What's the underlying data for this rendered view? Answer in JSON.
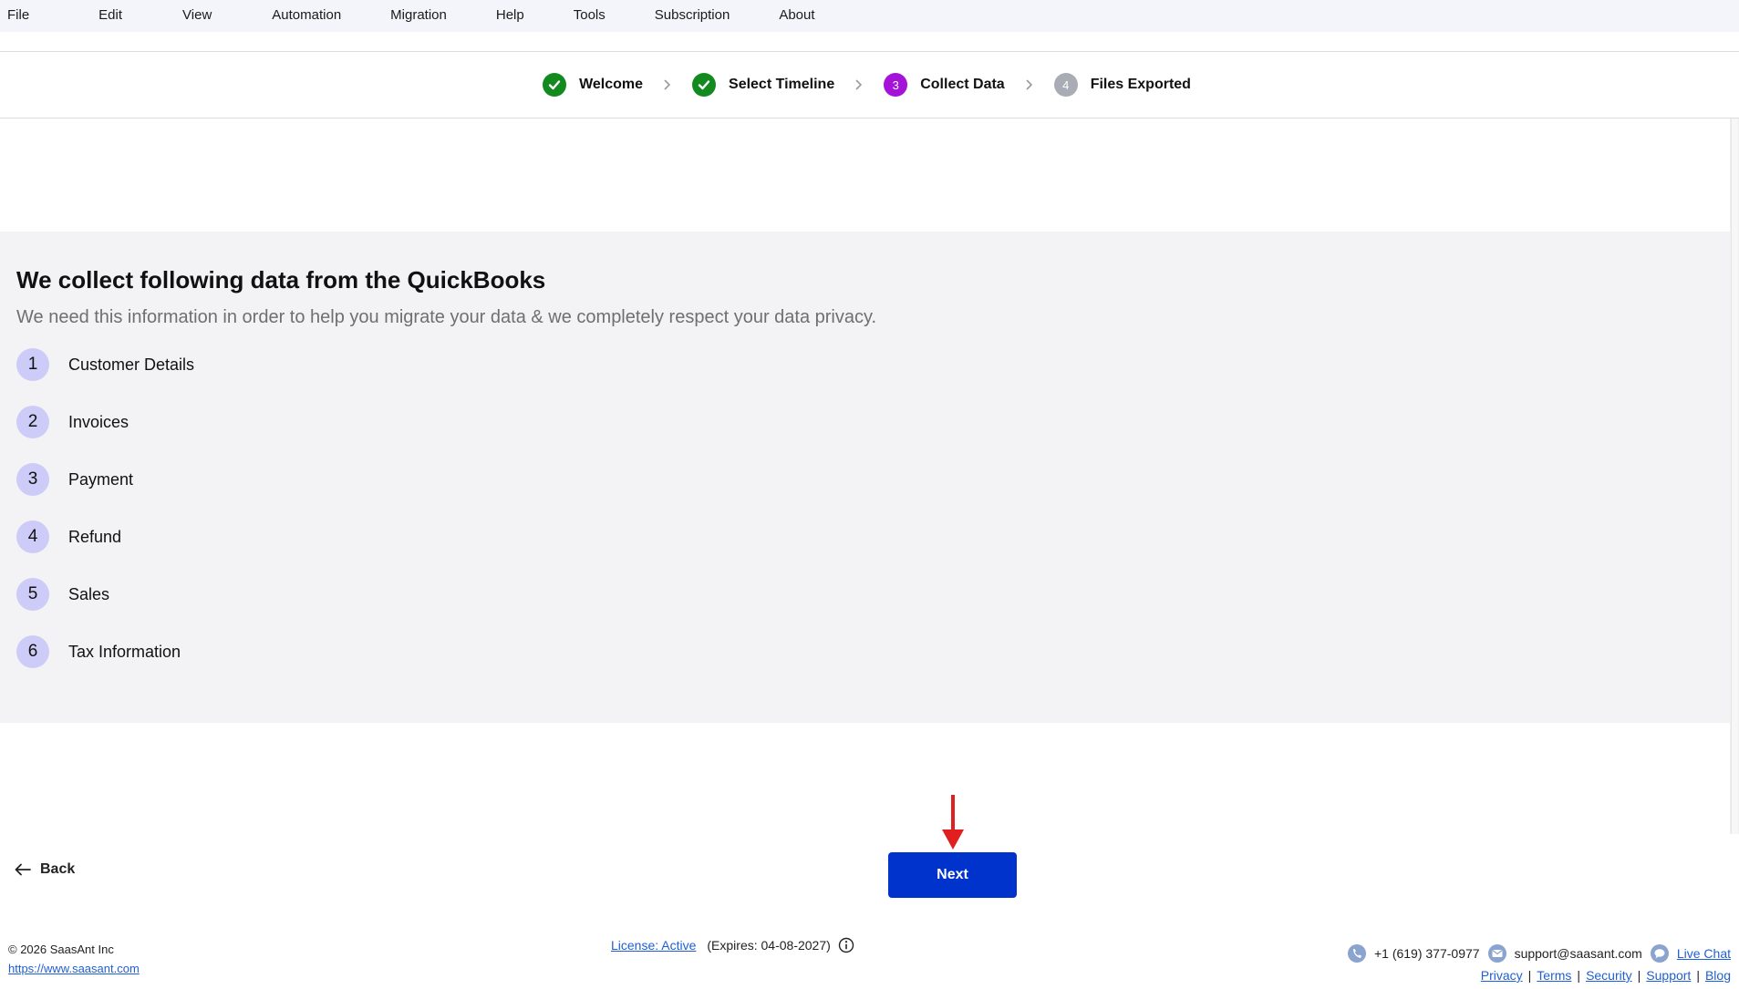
{
  "menu": [
    "File",
    "Edit",
    "View",
    "Automation",
    "Migration",
    "Help",
    "Tools",
    "Subscription",
    "About"
  ],
  "stepper": {
    "steps": [
      {
        "number": "1",
        "label": "Welcome",
        "state": "done"
      },
      {
        "number": "2",
        "label": "Select Timeline",
        "state": "done"
      },
      {
        "number": "3",
        "label": "Collect Data",
        "state": "current"
      },
      {
        "number": "4",
        "label": "Files Exported",
        "state": "pending"
      }
    ]
  },
  "panel": {
    "title": "We collect following data from the QuickBooks",
    "subtitle": "We need this information in order to help you migrate your data & we completely respect your data privacy.",
    "items": [
      {
        "number": "1",
        "label": "Customer Details"
      },
      {
        "number": "2",
        "label": "Invoices"
      },
      {
        "number": "3",
        "label": "Payment"
      },
      {
        "number": "4",
        "label": "Refund"
      },
      {
        "number": "5",
        "label": "Sales"
      },
      {
        "number": "6",
        "label": "Tax Information"
      }
    ]
  },
  "actions": {
    "back_label": "Back",
    "next_label": "Next"
  },
  "footer": {
    "copyright": "©  2026  SaasAnt Inc",
    "website": "https://www.saasant.com",
    "license_link": "License:  Active",
    "license_expiry": "(Expires: 04-08-2027)",
    "phone": "+1 (619) 377-0977",
    "email": "support@saasant.com",
    "live_chat": "Live Chat",
    "links": [
      "Privacy",
      "Terms",
      "Security",
      "Support",
      "Blog"
    ]
  },
  "colors": {
    "done": "#138a1f",
    "current": "#a512d8",
    "pending": "#a9acb5",
    "primary_button": "#0033cc",
    "number_circle": "#cdcbf7",
    "panel_bg": "#f3f3f6",
    "annotation_arrow": "#e02020"
  }
}
